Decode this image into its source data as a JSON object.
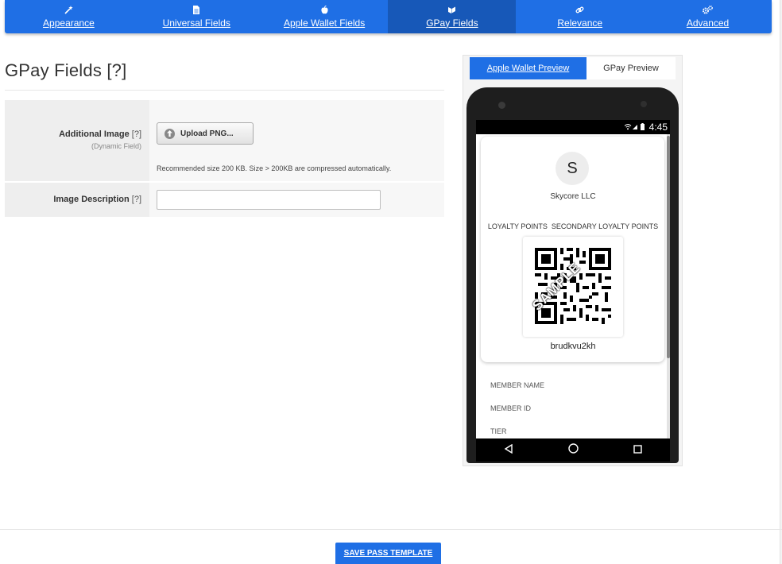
{
  "nav": {
    "tabs": [
      {
        "label": "Appearance",
        "icon": "magic-wand-icon"
      },
      {
        "label": "Universal Fields",
        "icon": "document-icon"
      },
      {
        "label": "Apple Wallet Fields",
        "icon": "apple-icon"
      },
      {
        "label": "GPay Fields",
        "icon": "gpay-icon"
      },
      {
        "label": "Relevance",
        "icon": "link-icon"
      },
      {
        "label": "Advanced",
        "icon": "gears-icon"
      }
    ],
    "active": "GPay Fields",
    "accent": "#1f6fe5"
  },
  "page": {
    "title": "GPay Fields",
    "title_help": "[?]"
  },
  "form": {
    "additional_image": {
      "label": "Additional Image",
      "help": "[?]",
      "sublabel": "(Dynamic Field)",
      "button": "Upload PNG...",
      "note": "Recommended size 200 KB. Size > 200KB are compressed automatically."
    },
    "image_description": {
      "label": "Image Description",
      "help": "[?]",
      "value": ""
    }
  },
  "preview": {
    "tabs": [
      "Apple Wallet Preview",
      "GPay Preview"
    ],
    "active_tab": "GPay Preview",
    "status_time": "4:45",
    "avatar_letter": "S",
    "company": "Skycore LLC",
    "points_label_1": "LOYALTY POINTS",
    "points_label_2": "SECONDARY LOYALTY POINTS",
    "watermark": "SAMPLE",
    "barcode_value": "brudkvu2kh",
    "fields": [
      "MEMBER NAME",
      "MEMBER ID",
      "TIER"
    ]
  },
  "footer": {
    "save_label": "SAVE PASS TEMPLATE"
  }
}
